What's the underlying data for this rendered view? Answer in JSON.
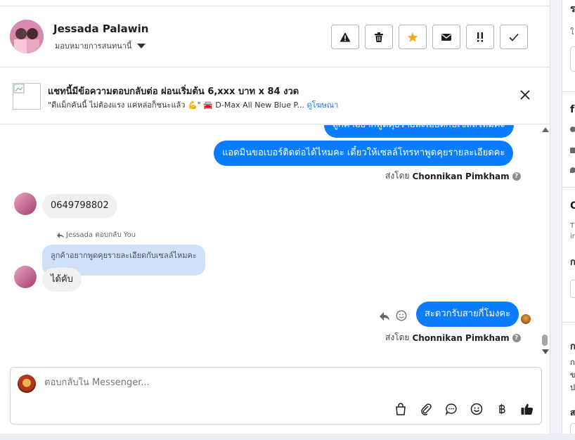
{
  "header": {
    "contact_name": "Jessada Palawin",
    "assign_label": "มอบหมายการสนทนานี้",
    "actions": [
      "warning-icon",
      "trash-icon",
      "star-icon",
      "mail-icon",
      "double-exclaim-icon",
      "check-icon"
    ],
    "star_color": "#f5a623"
  },
  "ad": {
    "title": "แชทนี้มีข้อความตอบกลับต่อ ผ่อนเริ่มต้น 6,xxx บาท x 84 งวด",
    "subtitle": "\"ดีแม็กคันนี้ ไม่ต้องแรง แค่หล่อก็ชนะแล้ว 💪\" 🚘 D-Max All New Blue P...",
    "link": "ดูโฆษณา"
  },
  "chat": {
    "msg_partial": "ลูกค้าอยากพูดคุยรายละเอียดกับเซลล์ไหมคะ",
    "msg_out_1": "แอดมินขอเบอร์ติดต่อได้ไหมคะ เดี๋ยวให้เซลล์โทรหาพูดคุยรายละเอียดคะ",
    "sent_by_label": "ส่งโดย",
    "sent_by_name": "Chonnikan Pimkham",
    "msg_in_phone": "0649798802",
    "reply_note": "Jessada ตอบกลับ You",
    "quoted_text": "ลูกค้าอยากพูดคุยรายละเอียดกับเซลล์ไหมคะ",
    "msg_in_reply": "ได้คับ",
    "msg_out_2": "สะดวกรับสายกี่โมงคะ",
    "accent": "#0a7cff"
  },
  "composer": {
    "placeholder": "ตอบกลับใน Messenger...",
    "icons": [
      "shopping-bag-icon",
      "paperclip-icon",
      "chat-bubble-icon",
      "emoji-icon",
      "baht-icon",
      "thumbs-up-icon"
    ]
  },
  "right_panel": {
    "fragments": [
      "ร",
      "ใ",
      "f",
      "C",
      "T",
      "ir",
      "ก",
      "ก",
      "ก",
      "ข",
      "ป",
      "ส"
    ]
  }
}
